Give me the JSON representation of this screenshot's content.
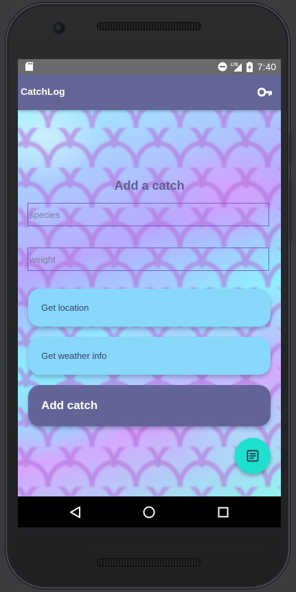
{
  "status_bar": {
    "network_label": "LTE",
    "time": "7:40"
  },
  "app_bar": {
    "title": "CatchLog",
    "action_icon": "key-icon"
  },
  "form": {
    "title": "Add a catch",
    "species": {
      "placeholder": "species",
      "value": ""
    },
    "weight": {
      "placeholder": "weight",
      "value": ""
    }
  },
  "buttons": {
    "get_location": "Get location",
    "get_weather": "Get weather info",
    "add_catch": "Add catch"
  },
  "fab": {
    "icon": "notes-icon"
  },
  "navigation": {
    "back_icon": "back-icon",
    "home_icon": "home-icon",
    "recents_icon": "recents-icon"
  },
  "colors": {
    "app_bar": "#636596",
    "status_bar": "#6a6a6a",
    "light_button": "#87d8fa",
    "primary_button": "#626497",
    "fab": "#1ee0cf",
    "field_border": "#7a5bc9",
    "title_text": "#5d5f8c"
  }
}
